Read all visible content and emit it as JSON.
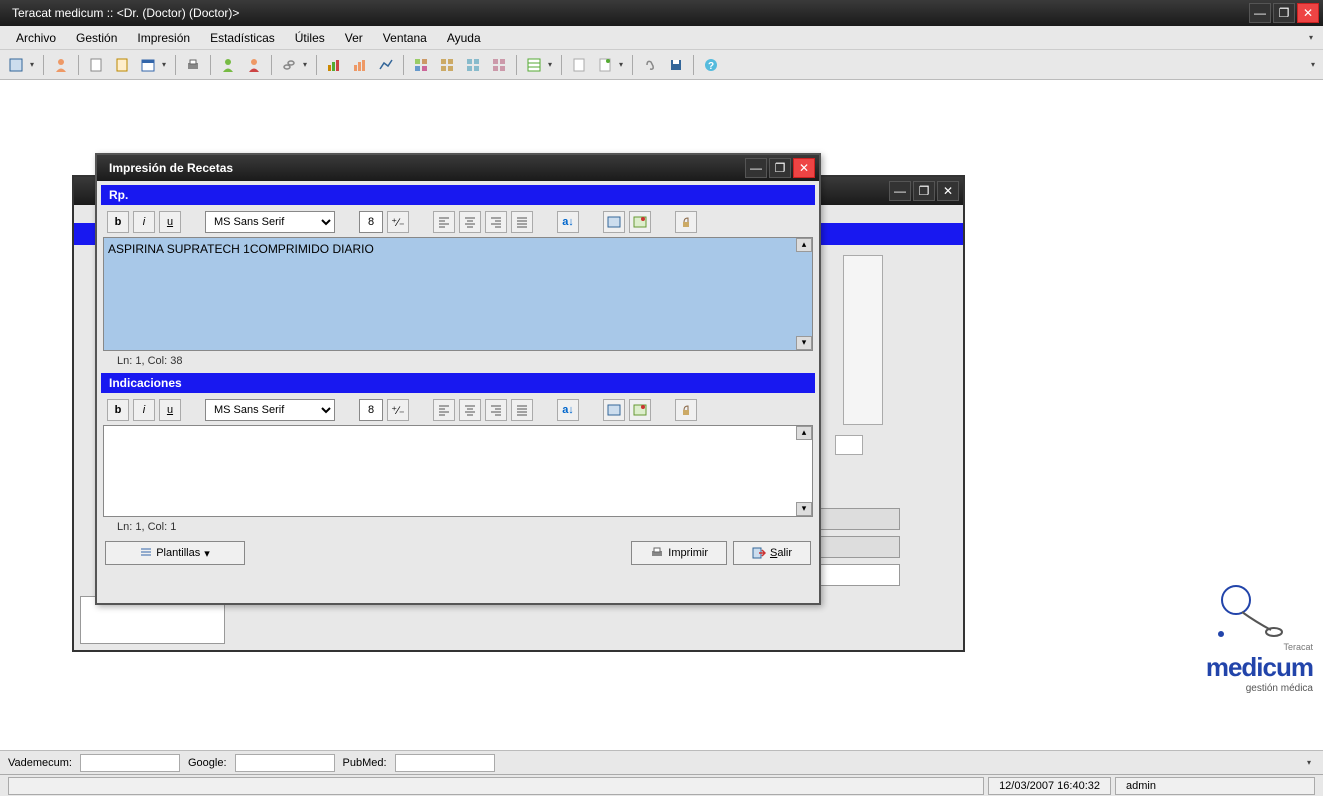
{
  "main_title": "Teracat medicum :: <Dr. (Doctor) (Doctor)>",
  "menu": [
    "Archivo",
    "Gestión",
    "Impresión",
    "Estadísticas",
    "Útiles",
    "Ver",
    "Ventana",
    "Ayuda"
  ],
  "rx_window": {
    "title": "Impresión de Recetas",
    "section1": "Rp.",
    "section2": "Indicaciones",
    "font": "MS Sans Serif",
    "size": "8",
    "content1": "ASPIRINA SUPRATECH 1COMPRIMIDO DIARIO",
    "content2": "",
    "status1": "Ln: 1, Col: 38",
    "status2": "Ln: 1, Col: 1",
    "btn_plantillas": "Plantillas",
    "btn_imprimir": "Imprimir",
    "btn_salir": "Salir"
  },
  "search_labels": {
    "v": "Vademecum:",
    "g": "Google:",
    "p": "PubMed:"
  },
  "status": {
    "datetime": "12/03/2007 16:40:32",
    "user": "admin"
  },
  "logo": {
    "brand": "Teracat",
    "name": "medicum",
    "sub": "gestión médica"
  }
}
